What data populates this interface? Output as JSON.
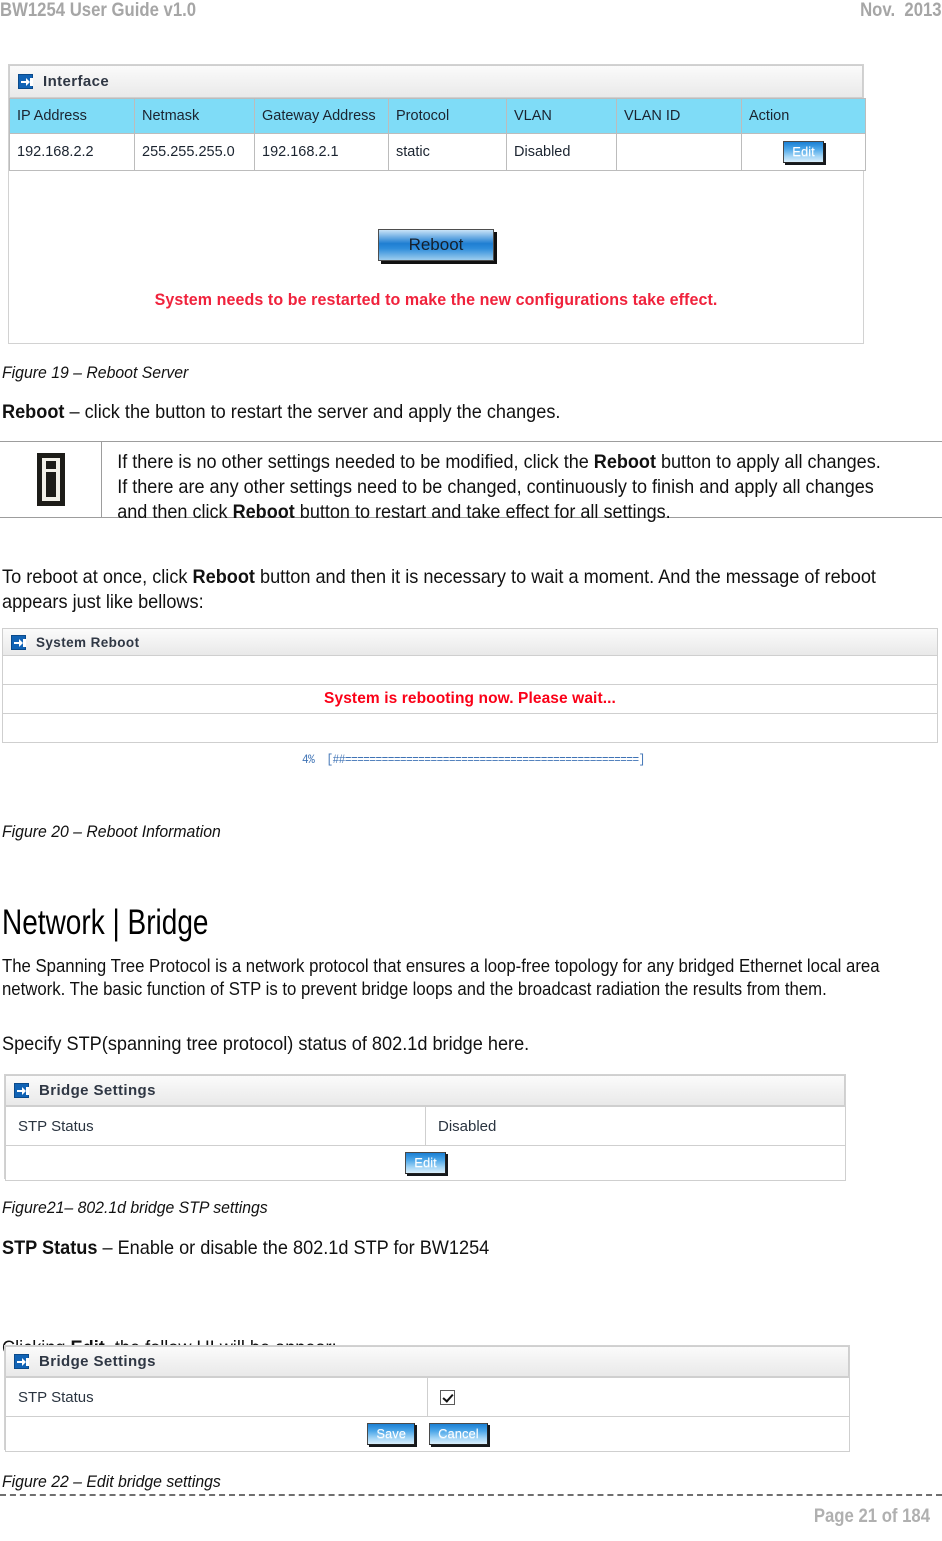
{
  "header": {
    "left": "BW1254 User Guide v1.0",
    "right": "Nov.  2013"
  },
  "footer": {
    "page_label": "Page 21 of 184"
  },
  "figure19": {
    "panel_title": "Interface",
    "table": {
      "columns": [
        "IP Address",
        "Netmask",
        "Gateway Address",
        "Protocol",
        "VLAN",
        "VLAN ID",
        "Action"
      ],
      "rows": [
        {
          "ip_address": "192.168.2.2",
          "netmask": "255.255.255.0",
          "gateway_address": "192.168.2.1",
          "protocol": "static",
          "vlan": "Disabled",
          "vlan_id": "",
          "action_button": "Edit"
        }
      ]
    },
    "reboot_button": "Reboot",
    "warning": "System needs to be restarted to make the new configurations take effect.",
    "caption": "Figure 19 – Reboot Server"
  },
  "reboot_desc": {
    "term": "Reboot",
    "rest": " – click the button to restart the server and apply the changes."
  },
  "note": {
    "icon": "info-icon",
    "text_part1": "If there is no other settings needed to be modified, click the ",
    "bold1": "Reboot",
    "text_part2": " button to apply all changes. If there are any other settings need to be changed, continuously to finish and apply all changes and then click ",
    "bold2": "Reboot",
    "text_part3": " button to restart and take effect for all settings."
  },
  "intro_reboot": {
    "part1": "To reboot at once, click ",
    "bold1": "Reboot",
    "part2": " button and then it is necessary to wait a moment. And the message of reboot appears just like bellows:"
  },
  "figure20": {
    "panel_title": "System Reboot",
    "message": "System is rebooting now. Please wait...",
    "progress_percent": "4%",
    "progress_bar": "4%  [##================================================]",
    "caption": "Figure 20 – Reboot Information"
  },
  "section": {
    "title": "Network | Bridge",
    "paragraph1": "The Spanning Tree Protocol is a network protocol that ensures a loop-free topology for any bridged Ethernet local area network. The basic function of STP is to prevent bridge loops and the broadcast radiation the results from them.",
    "paragraph2": "Specify STP(spanning tree protocol) status of 802.1d bridge here."
  },
  "figure21": {
    "panel_title": "Bridge Settings",
    "row_label": "STP Status",
    "row_value": "Disabled",
    "edit_button": "Edit",
    "caption": "Figure21– 802.1d bridge STP settings"
  },
  "stp_desc": {
    "term": "STP Status",
    "rest": " – Enable or disable the 802.1d STP for BW1254"
  },
  "clicking_edit": {
    "part1": "Clicking ",
    "bold1": "Edit",
    "part2": ", the follow UI will be appear:"
  },
  "figure22": {
    "panel_title": "Bridge Settings",
    "row_label": "STP Status",
    "checkbox_checked": "checked",
    "save_button": "Save",
    "cancel_button": "Cancel",
    "caption": "Figure 22 – Edit bridge settings"
  },
  "colors": {
    "table_header": "#7fdcf7",
    "warning_red": "#f0223c",
    "message_red": "#fb0017",
    "button_blue": "#1b7fd4",
    "progress_blue": "#3f73b5",
    "header_gray": "#a6a6a6"
  }
}
